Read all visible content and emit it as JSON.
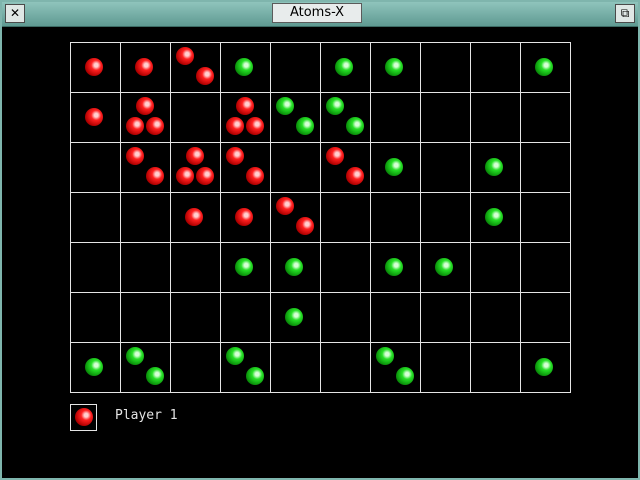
{
  "window": {
    "title": "Atoms-X"
  },
  "colors": {
    "red": "#ff2020",
    "green": "#26e026",
    "grid": "#e5e5e5",
    "frame": "#7fb5ad"
  },
  "board": {
    "cols": 10,
    "rows": 7,
    "cells": [
      [
        {
          "c": "r",
          "n": 1
        },
        {
          "c": "r",
          "n": 1
        },
        {
          "c": "r",
          "n": 2
        },
        {
          "c": "g",
          "n": 1
        },
        {
          "c": "",
          "n": 0
        },
        {
          "c": "g",
          "n": 1
        },
        {
          "c": "g",
          "n": 1
        },
        {
          "c": "",
          "n": 0
        },
        {
          "c": "",
          "n": 0
        },
        {
          "c": "g",
          "n": 1
        }
      ],
      [
        {
          "c": "r",
          "n": 1
        },
        {
          "c": "r",
          "n": 3
        },
        {
          "c": "",
          "n": 0
        },
        {
          "c": "r",
          "n": 3
        },
        {
          "c": "g",
          "n": 2
        },
        {
          "c": "g",
          "n": 2
        },
        {
          "c": "",
          "n": 0
        },
        {
          "c": "",
          "n": 0
        },
        {
          "c": "",
          "n": 0
        },
        {
          "c": "",
          "n": 0
        }
      ],
      [
        {
          "c": "",
          "n": 0
        },
        {
          "c": "r",
          "n": 2
        },
        {
          "c": "r",
          "n": 3
        },
        {
          "c": "r",
          "n": 2
        },
        {
          "c": "",
          "n": 0
        },
        {
          "c": "r",
          "n": 2
        },
        {
          "c": "g",
          "n": 1
        },
        {
          "c": "",
          "n": 0
        },
        {
          "c": "g",
          "n": 1
        },
        {
          "c": "",
          "n": 0
        }
      ],
      [
        {
          "c": "",
          "n": 0
        },
        {
          "c": "",
          "n": 0
        },
        {
          "c": "r",
          "n": 1
        },
        {
          "c": "r",
          "n": 1
        },
        {
          "c": "r",
          "n": 2
        },
        {
          "c": "",
          "n": 0
        },
        {
          "c": "",
          "n": 0
        },
        {
          "c": "",
          "n": 0
        },
        {
          "c": "g",
          "n": 1
        },
        {
          "c": "",
          "n": 0
        }
      ],
      [
        {
          "c": "",
          "n": 0
        },
        {
          "c": "",
          "n": 0
        },
        {
          "c": "",
          "n": 0
        },
        {
          "c": "g",
          "n": 1
        },
        {
          "c": "g",
          "n": 1
        },
        {
          "c": "",
          "n": 0
        },
        {
          "c": "g",
          "n": 1
        },
        {
          "c": "g",
          "n": 1
        },
        {
          "c": "",
          "n": 0
        },
        {
          "c": "",
          "n": 0
        }
      ],
      [
        {
          "c": "",
          "n": 0
        },
        {
          "c": "",
          "n": 0
        },
        {
          "c": "",
          "n": 0
        },
        {
          "c": "",
          "n": 0
        },
        {
          "c": "g",
          "n": 1
        },
        {
          "c": "",
          "n": 0
        },
        {
          "c": "",
          "n": 0
        },
        {
          "c": "",
          "n": 0
        },
        {
          "c": "",
          "n": 0
        },
        {
          "c": "",
          "n": 0
        }
      ],
      [
        {
          "c": "g",
          "n": 1
        },
        {
          "c": "g",
          "n": 2
        },
        {
          "c": "",
          "n": 0
        },
        {
          "c": "g",
          "n": 2
        },
        {
          "c": "",
          "n": 0
        },
        {
          "c": "",
          "n": 0
        },
        {
          "c": "g",
          "n": 2
        },
        {
          "c": "",
          "n": 0
        },
        {
          "c": "",
          "n": 0
        },
        {
          "c": "g",
          "n": 1
        }
      ]
    ]
  },
  "status": {
    "current_player_label": "Player 1",
    "current_player_color": "r"
  },
  "icons": {
    "close": "close-icon",
    "maximize": "maximize-icon"
  }
}
